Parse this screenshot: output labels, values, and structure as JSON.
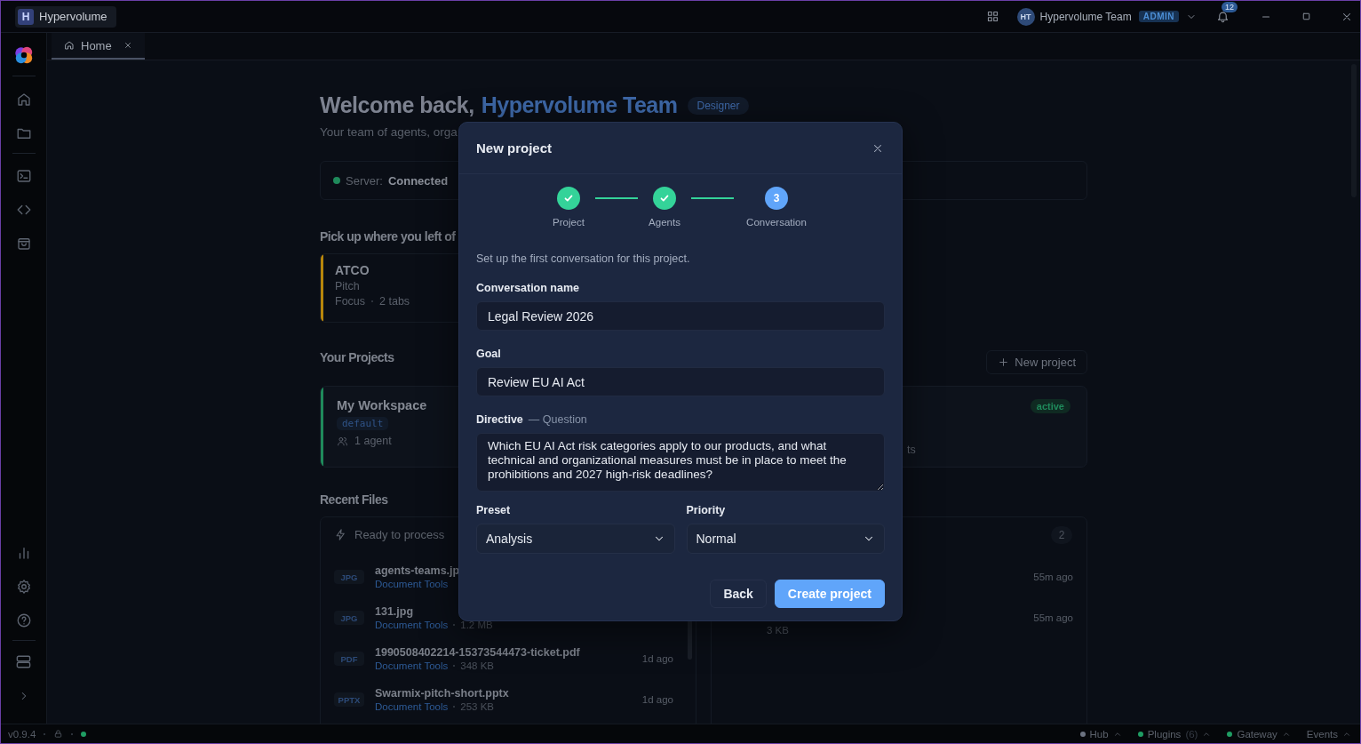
{
  "window": {
    "title": "Hypervolume",
    "logo_letter": "H"
  },
  "titlebar": {
    "user_initials": "HT",
    "user_name": "Hypervolume Team",
    "role_badge": "ADMIN",
    "notifications": "12"
  },
  "tabs": [
    {
      "label": "Home",
      "selected": true
    }
  ],
  "home": {
    "greeting": "Welcome back,",
    "user_name": "Hypervolume Team",
    "role": "Designer",
    "subtitle": "Your team of agents, orga",
    "server": {
      "label": "Server:",
      "status": "Connected",
      "connected": true
    },
    "resume": {
      "title": "Pick up where you left of",
      "cards": [
        {
          "name": "ATCO",
          "subtitle": "Pitch",
          "mode": "Focus",
          "tabs": "2 tabs",
          "color": "#b8860b"
        }
      ]
    },
    "projects": {
      "title": "Your Projects",
      "new_button": "New project",
      "cards": [
        {
          "name": "My Workspace",
          "tag": "default",
          "agents": "1 agent",
          "color": "#1f8a5b"
        },
        {
          "agents": "ts",
          "status": "active"
        }
      ]
    },
    "recent_files": {
      "title": "Recent Files",
      "ready": {
        "label": "Ready to process",
        "files": [
          {
            "type": "JPG",
            "name": "agents-teams.jp",
            "tool": "Document Tools"
          },
          {
            "type": "JPG",
            "name": "131.jpg",
            "tool": "Document Tools",
            "size": "1.2 MB"
          },
          {
            "type": "PDF",
            "name": "1990508402214-15373544473-ticket.pdf",
            "tool": "Document Tools",
            "size": "348 KB",
            "time": "1d ago"
          },
          {
            "type": "PPTX",
            "name": "Swarmix-pitch-short.pptx",
            "tool": "Document Tools",
            "size": "253 KB",
            "time": "1d ago"
          }
        ]
      },
      "other": {
        "count": "2",
        "rows": [
          {
            "time": "55m ago"
          },
          {
            "time": "55m ago",
            "size": "3 KB"
          }
        ]
      }
    }
  },
  "dialog": {
    "title": "New project",
    "steps": [
      {
        "label": "Project",
        "completed": true,
        "current": false
      },
      {
        "label": "Agents",
        "completed": true,
        "current": false
      },
      {
        "label": "Conversation",
        "completed": false,
        "current": true,
        "number": "3"
      }
    ],
    "intro": "Set up the first conversation for this project.",
    "fields": [
      {
        "kind": "text",
        "label": "Conversation name",
        "value": "Legal Review 2026"
      },
      {
        "kind": "text",
        "label": "Goal",
        "value": "Review EU AI Act"
      },
      {
        "kind": "textarea",
        "label": "Directive",
        "hint": "— Question",
        "value": "Which EU AI Act risk categories apply to our products, and what technical and organizational measures must be in place to meet the prohibitions and 2027 high-risk deadlines?"
      }
    ],
    "selects": [
      {
        "label": "Preset",
        "value": "Analysis"
      },
      {
        "label": "Priority",
        "value": "Normal"
      }
    ],
    "buttons": [
      {
        "label": "Back",
        "kind": "secondary"
      },
      {
        "label": "Create project",
        "kind": "primary"
      }
    ]
  },
  "status_bar": {
    "version": "v0.9.4",
    "items": [
      {
        "label": "Hub",
        "color": "#6b7280"
      },
      {
        "label": "Plugins",
        "count": "(6)",
        "color": "#1f9d63"
      },
      {
        "label": "Gateway",
        "color": "#1f9d63"
      },
      {
        "label": "Events"
      }
    ]
  }
}
